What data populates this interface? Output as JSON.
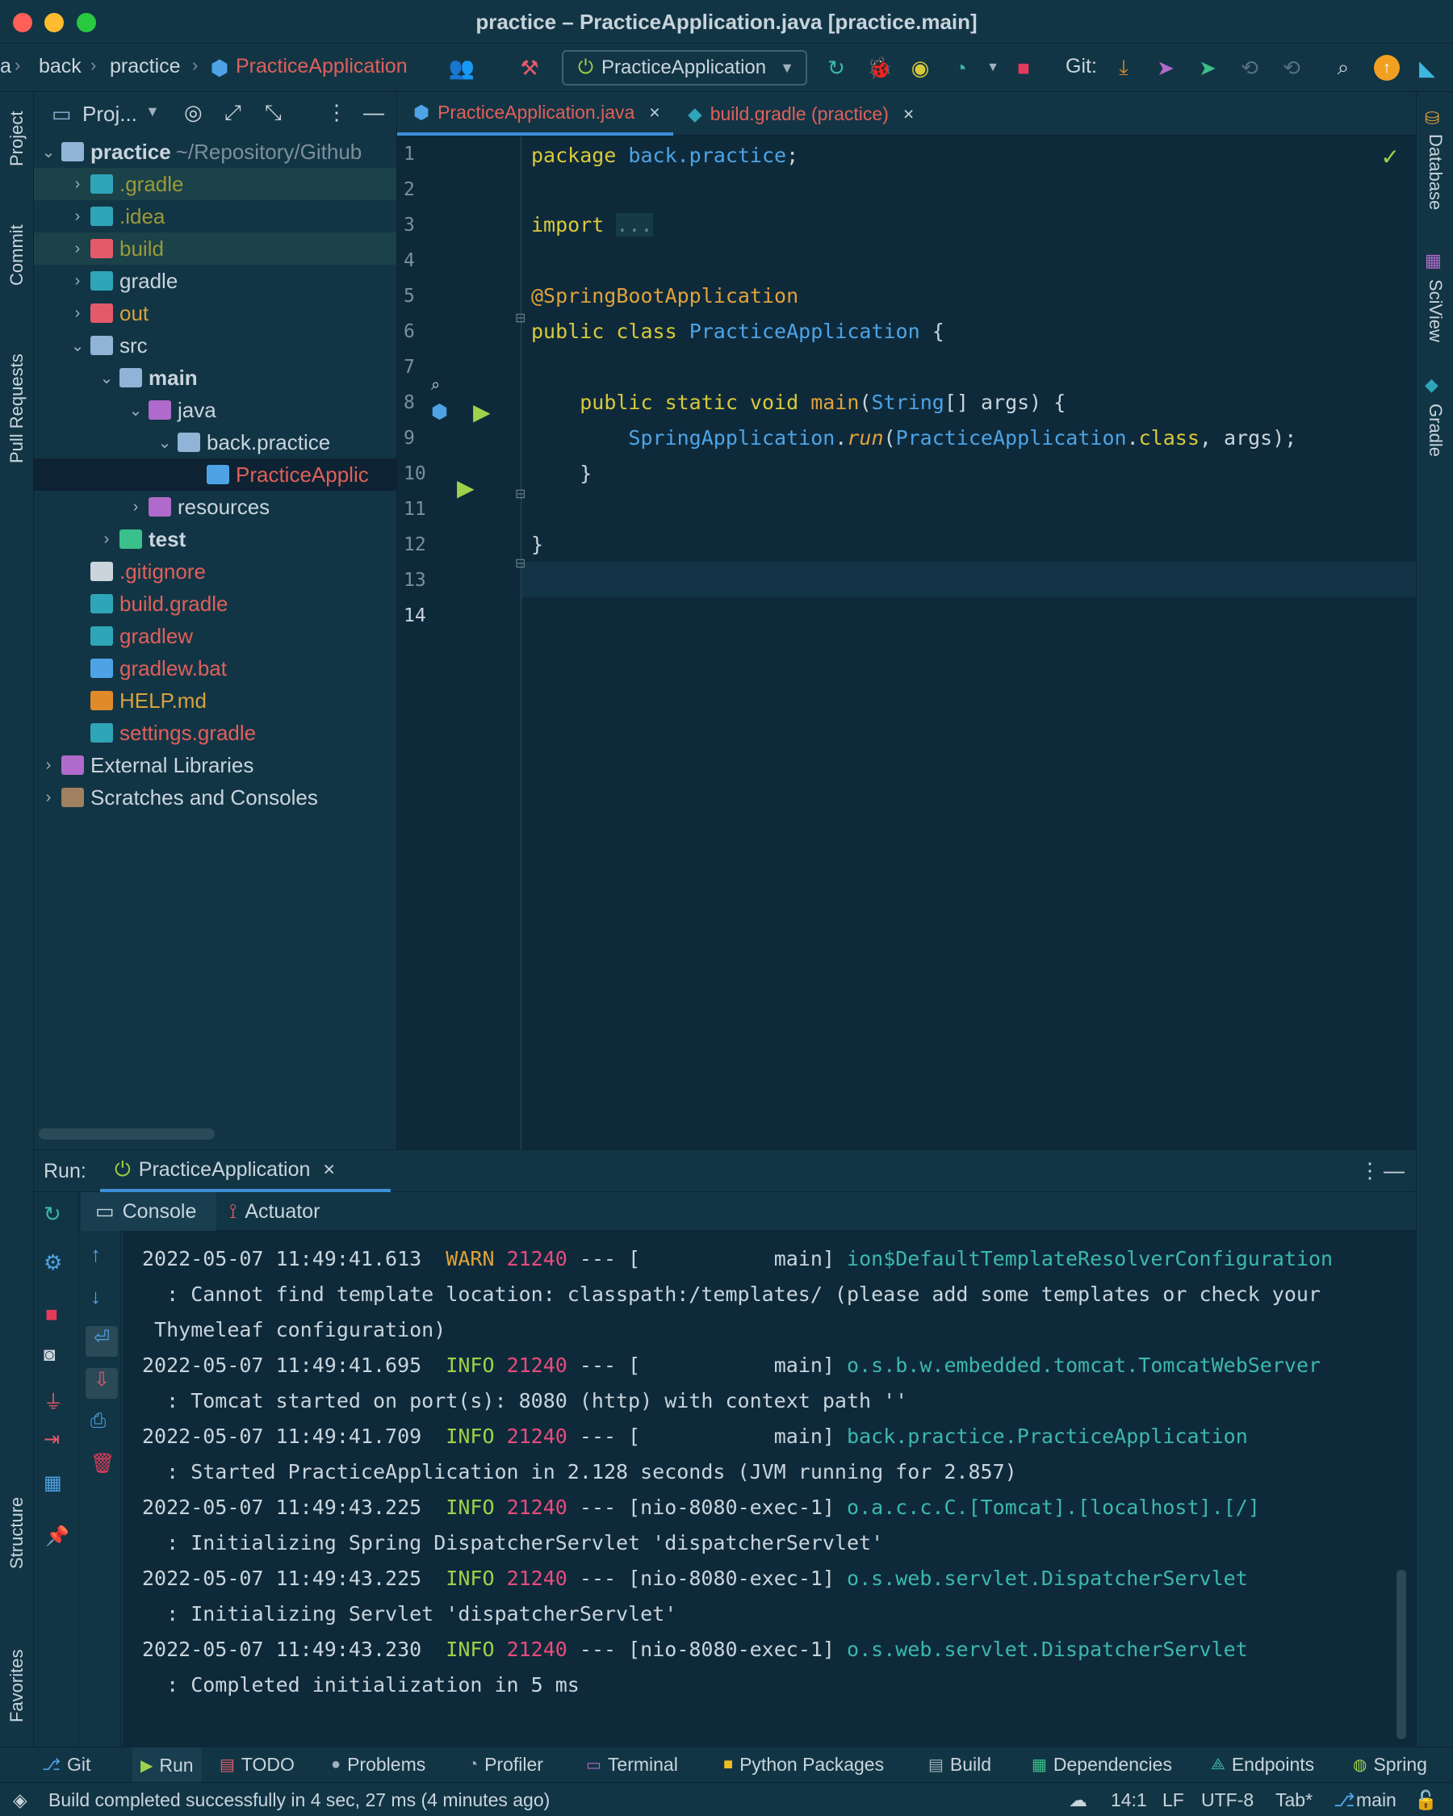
{
  "window": {
    "title": "practice – PracticeApplication.java [practice.main]"
  },
  "breadcrumbs": [
    "a",
    "back",
    "practice",
    "PracticeApplication"
  ],
  "toolbar": {
    "run_config": "PracticeApplication",
    "git_label": "Git:"
  },
  "left_strip": [
    "Project",
    "Commit",
    "Pull Requests",
    "Structure",
    "Favorites"
  ],
  "right_strip": [
    "Database",
    "SciView",
    "Gradle"
  ],
  "project": {
    "header": "Proj...",
    "tree": [
      {
        "label": "practice",
        "extra": "~/Repository/Github",
        "depth": 0,
        "arrow": "v",
        "color": "#c9d4dc",
        "bold": true,
        "icon": "folder-icon",
        "icon_color": "#8fb4d6"
      },
      {
        "label": ".gradle",
        "depth": 1,
        "arrow": ">",
        "color": "#9a9a3a",
        "icon": "gradle-folder-icon",
        "icon_color": "#2fa5b8",
        "hl": true
      },
      {
        "label": ".idea",
        "depth": 1,
        "arrow": ">",
        "color": "#9a9a3a",
        "icon": "idea-folder-icon",
        "icon_color": "#2fa5b8"
      },
      {
        "label": "build",
        "depth": 1,
        "arrow": ">",
        "color": "#9a9a3a",
        "icon": "build-folder-icon",
        "icon_color": "#e45a6a",
        "hl": true
      },
      {
        "label": "gradle",
        "depth": 1,
        "arrow": ">",
        "color": "#c9d4dc",
        "icon": "gradle-folder-icon",
        "icon_color": "#2fa5b8"
      },
      {
        "label": "out",
        "depth": 1,
        "arrow": ">",
        "color": "#d8a23a",
        "icon": "out-folder-icon",
        "icon_color": "#e45a6a"
      },
      {
        "label": "src",
        "depth": 1,
        "arrow": "v",
        "color": "#c9d4dc",
        "icon": "src-folder-icon",
        "icon_color": "#8fb4d6"
      },
      {
        "label": "main",
        "depth": 2,
        "arrow": "v",
        "color": "#c9d4dc",
        "bold": true,
        "icon": "folder-icon",
        "icon_color": "#8fb4d6"
      },
      {
        "label": "java",
        "depth": 3,
        "arrow": "v",
        "color": "#c9d4dc",
        "icon": "java-folder-icon",
        "icon_color": "#b06acb"
      },
      {
        "label": "back.practice",
        "depth": 4,
        "arrow": "v",
        "color": "#c9d4dc",
        "icon": "package-icon",
        "icon_color": "#8fb4d6"
      },
      {
        "label": "PracticeApplic",
        "depth": 5,
        "arrow": "",
        "color": "#e0605a",
        "icon": "spring-class-icon",
        "icon_color": "#4ea3e6",
        "sel": true
      },
      {
        "label": "resources",
        "depth": 3,
        "arrow": ">",
        "color": "#c9d4dc",
        "icon": "resources-folder-icon",
        "icon_color": "#b06acb"
      },
      {
        "label": "test",
        "depth": 2,
        "arrow": ">",
        "color": "#c9d4dc",
        "bold": true,
        "icon": "test-folder-icon",
        "icon_color": "#3ac08a"
      },
      {
        "label": ".gitignore",
        "depth": 1,
        "arrow": "",
        "color": "#e0605a",
        "icon": "git-icon",
        "icon_color": "#c9d4dc"
      },
      {
        "label": "build.gradle",
        "depth": 1,
        "arrow": "",
        "color": "#e0605a",
        "icon": "gradle-icon",
        "icon_color": "#2fa5b8"
      },
      {
        "label": "gradlew",
        "depth": 1,
        "arrow": "",
        "color": "#e0605a",
        "icon": "gradle-icon",
        "icon_color": "#2fa5b8"
      },
      {
        "label": "gradlew.bat",
        "depth": 1,
        "arrow": "",
        "color": "#e0605a",
        "icon": "windows-icon",
        "icon_color": "#4ea3e6"
      },
      {
        "label": "HELP.md",
        "depth": 1,
        "arrow": "",
        "color": "#d8a23a",
        "icon": "markdown-icon",
        "icon_color": "#e08a2a"
      },
      {
        "label": "settings.gradle",
        "depth": 1,
        "arrow": "",
        "color": "#e0605a",
        "icon": "gradle-icon",
        "icon_color": "#2fa5b8"
      },
      {
        "label": "External Libraries",
        "depth": 0,
        "arrow": ">",
        "color": "#c9d4dc",
        "icon": "library-icon",
        "icon_color": "#b06acb"
      },
      {
        "label": "Scratches and Consoles",
        "depth": 0,
        "arrow": ">",
        "color": "#c9d4dc",
        "icon": "scratches-icon",
        "icon_color": "#a08060"
      }
    ]
  },
  "editor": {
    "tabs": [
      {
        "label": "PracticeApplication.java",
        "active": true
      },
      {
        "label": "build.gradle (practice)",
        "active": false
      }
    ],
    "line_numbers": [
      "1",
      "2",
      "3",
      "4",
      "5",
      "6",
      "7",
      "8",
      "9",
      "10",
      "11",
      "12",
      "13",
      "14"
    ]
  },
  "run": {
    "label": "Run:",
    "tab": "PracticeApplication",
    "subtabs": [
      "Console",
      "Actuator"
    ],
    "console_lines": [
      {
        "ts": "2022-05-07 11:49:41.613",
        "level": "WARN",
        "pid": "21240",
        "sep": "--- [           main]",
        "logger": "ion$DefaultTemplateResolverConfiguration"
      },
      {
        "msg": "  : Cannot find template location: classpath:/templates/ (please add some templates or check your"
      },
      {
        "msg": " Thymeleaf configuration)"
      },
      {
        "ts": "2022-05-07 11:49:41.695",
        "level": "INFO",
        "pid": "21240",
        "sep": "--- [           main]",
        "logger": "o.s.b.w.embedded.tomcat.TomcatWebServer"
      },
      {
        "msg": "  : Tomcat started on port(s): 8080 (http) with context path ''"
      },
      {
        "ts": "2022-05-07 11:49:41.709",
        "level": "INFO",
        "pid": "21240",
        "sep": "--- [           main]",
        "logger": "back.practice.PracticeApplication"
      },
      {
        "msg": "  : Started PracticeApplication in 2.128 seconds (JVM running for 2.857)"
      },
      {
        "ts": "2022-05-07 11:49:43.225",
        "level": "INFO",
        "pid": "21240",
        "sep": "--- [nio-8080-exec-1]",
        "logger": "o.a.c.c.C.[Tomcat].[localhost].[/]"
      },
      {
        "msg": "  : Initializing Spring DispatcherServlet 'dispatcherServlet'"
      },
      {
        "ts": "2022-05-07 11:49:43.225",
        "level": "INFO",
        "pid": "21240",
        "sep": "--- [nio-8080-exec-1]",
        "logger": "o.s.web.servlet.DispatcherServlet"
      },
      {
        "msg": "  : Initializing Servlet 'dispatcherServlet'"
      },
      {
        "ts": "2022-05-07 11:49:43.230",
        "level": "INFO",
        "pid": "21240",
        "sep": "--- [nio-8080-exec-1]",
        "logger": "o.s.web.servlet.DispatcherServlet"
      },
      {
        "msg": "  : Completed initialization in 5 ms"
      }
    ]
  },
  "bottom_tabs": [
    "Git",
    "Run",
    "TODO",
    "Problems",
    "Profiler",
    "Terminal",
    "Python Packages",
    "Build",
    "Dependencies",
    "Endpoints",
    "Spring"
  ],
  "status": {
    "message": "Build completed successfully in 4 sec, 27 ms (4 minutes ago)",
    "position": "14:1",
    "line_sep": "LF",
    "encoding": "UTF-8",
    "indent": "Tab*",
    "branch": "main"
  }
}
